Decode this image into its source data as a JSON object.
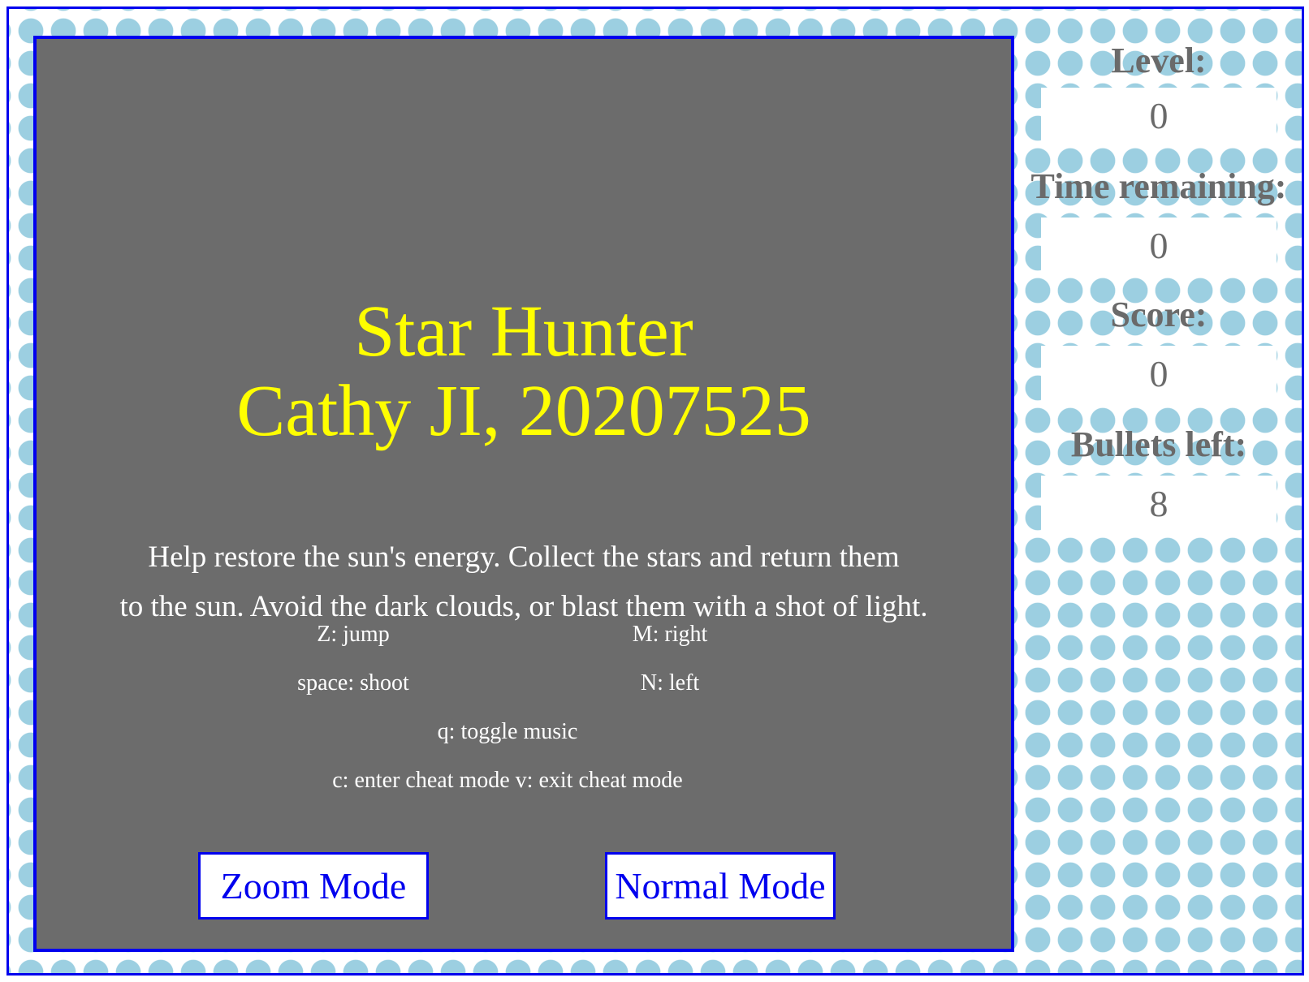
{
  "game": {
    "title_line1": "Star Hunter",
    "title_line2": "Cathy JI, 20207525",
    "intro_line1": "Help restore the sun's energy. Collect the stars and return them",
    "intro_line2": "to the sun. Avoid the dark clouds, or blast them with a shot of light."
  },
  "controls": {
    "jump": "Z: jump",
    "right": "M: right",
    "shoot": "space: shoot",
    "left": "N: left",
    "music": "q: toggle music",
    "cheat": "c: enter cheat mode v: exit cheat mode"
  },
  "buttons": {
    "zoom_mode": "Zoom Mode",
    "normal_mode": "Normal Mode"
  },
  "status": {
    "level_label": "Level:",
    "level_value": "0",
    "time_label": "Time remaining:",
    "time_value": "0",
    "score_label": "Score:",
    "score_value": "0",
    "bullets_label": "Bullets left:",
    "bullets_value": "8"
  },
  "colors": {
    "border": "#0000ee",
    "screen_background": "#6c6c6c",
    "title": "#ffff00",
    "dots": "#9ccfe1",
    "status_text": "#6a6a6a"
  }
}
